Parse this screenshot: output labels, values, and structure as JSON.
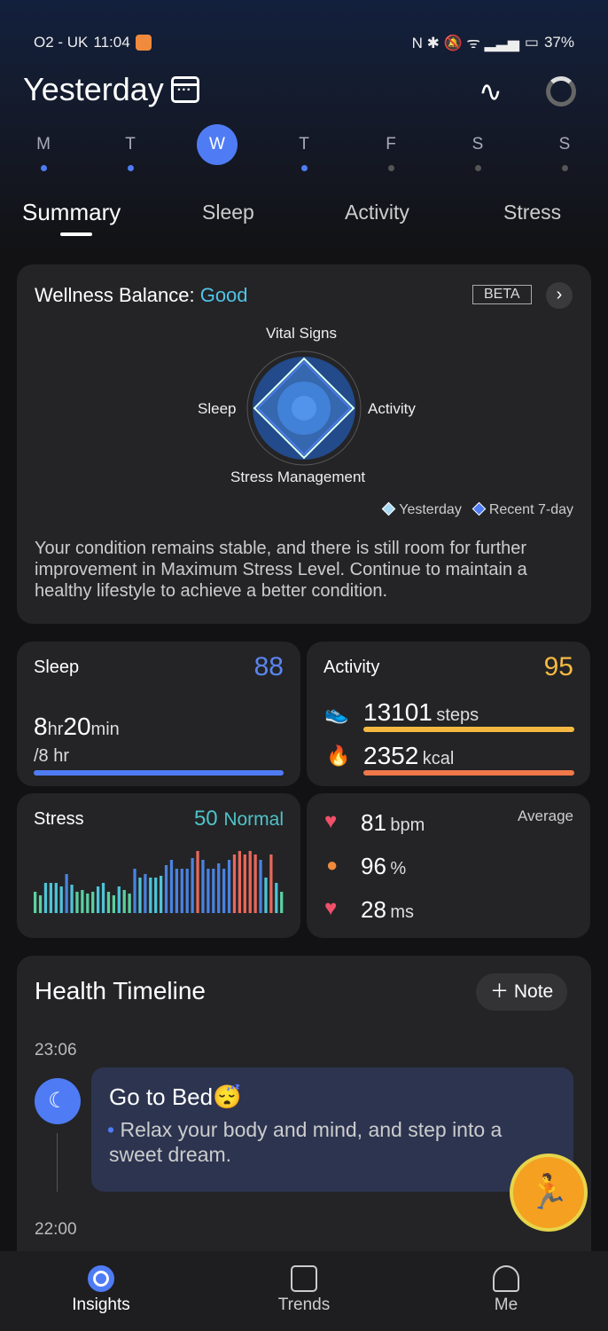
{
  "status": {
    "carrier": "O2 - UK",
    "time": "11:04",
    "battery": "37%"
  },
  "header": {
    "title": "Yesterday"
  },
  "days": [
    {
      "l": "M",
      "dot": true
    },
    {
      "l": "T",
      "dot": true
    },
    {
      "l": "W",
      "sel": true
    },
    {
      "l": "T",
      "dot": true
    },
    {
      "l": "F",
      "dot": false
    },
    {
      "l": "S",
      "dot": false
    },
    {
      "l": "S",
      "dot": false
    }
  ],
  "tabs": [
    "Summary",
    "Sleep",
    "Activity",
    "Stress"
  ],
  "wellness": {
    "title": "Wellness Balance:",
    "rating": "Good",
    "beta": "BETA",
    "axes": {
      "top": "Vital Signs",
      "left": "Sleep",
      "right": "Activity",
      "bottom": "Stress Management"
    },
    "legend": [
      "Yesterday",
      "Recent 7-day"
    ],
    "desc": "Your condition remains stable, and there is still room for further improvement in Maximum Stress Level. Continue to maintain a healthy lifestyle to achieve a better condition."
  },
  "sleep": {
    "label": "Sleep",
    "score": "88",
    "hr": "8",
    "hr_u": "hr",
    "min": "20",
    "min_u": "min",
    "goal": "/8 hr",
    "progress": 100
  },
  "activity": {
    "label": "Activity",
    "score": "95",
    "steps": "13101",
    "steps_u": "steps",
    "kcal": "2352",
    "kcal_u": "kcal",
    "steps_progress": 100,
    "kcal_progress": 100
  },
  "stress": {
    "label": "Stress",
    "value": "50",
    "level": "Normal",
    "bars": [
      24,
      20,
      34,
      34,
      34,
      30,
      44,
      32,
      24,
      26,
      22,
      24,
      30,
      34,
      24,
      20,
      30,
      26,
      22,
      50,
      40,
      44,
      40,
      40,
      42,
      54,
      60,
      50,
      50,
      50,
      62,
      70,
      60,
      50,
      50,
      56,
      50,
      60,
      66,
      70,
      66,
      70,
      66,
      60,
      40,
      66,
      34,
      24
    ]
  },
  "vitals": {
    "average": "Average",
    "hr": "81",
    "hr_u": "bpm",
    "spo2": "96",
    "spo2_u": "%",
    "hrv": "28",
    "hrv_u": "ms"
  },
  "timeline": {
    "title": "Health Timeline",
    "note": "Note",
    "t1": "23:06",
    "e1_title": "Go to Bed😴",
    "e1_text": "Relax your body and mind, and step into a sweet dream.",
    "t2": "22:00"
  },
  "nav": [
    "Insights",
    "Trends",
    "Me"
  ]
}
